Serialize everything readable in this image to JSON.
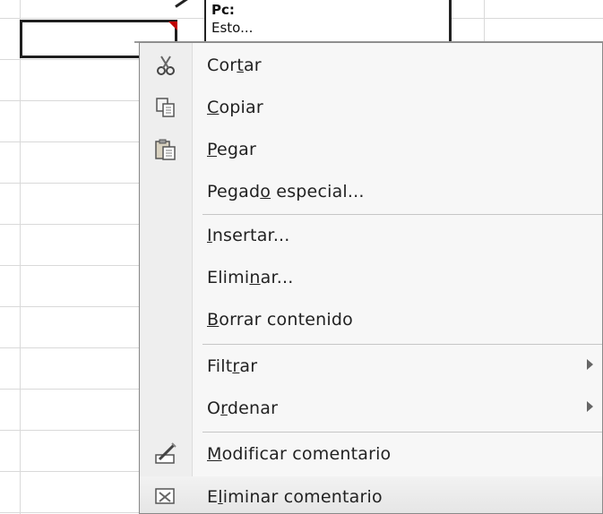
{
  "comment": {
    "author": "Pc:",
    "text": "Esto..."
  },
  "menu": {
    "items": [
      {
        "pre": "Cor",
        "acc": "t",
        "post": "ar",
        "icon": "scissors-icon"
      },
      {
        "pre": "",
        "acc": "C",
        "post": "opiar",
        "icon": "copy-icon"
      },
      {
        "pre": "",
        "acc": "P",
        "post": "egar",
        "icon": "paste-icon"
      },
      {
        "pre": "Pegad",
        "acc": "o",
        "post": " especial...",
        "icon": ""
      },
      {
        "pre": "",
        "acc": "I",
        "post": "nsertar...",
        "icon": ""
      },
      {
        "pre": "Elimi",
        "acc": "n",
        "post": "ar...",
        "icon": ""
      },
      {
        "pre": "",
        "acc": "B",
        "post": "orrar contenido",
        "icon": ""
      },
      {
        "pre": "Filt",
        "acc": "r",
        "post": "ar",
        "icon": "",
        "submenu": true
      },
      {
        "pre": "O",
        "acc": "r",
        "post": "denar",
        "icon": "",
        "submenu": true
      },
      {
        "pre": "",
        "acc": "M",
        "post": "odificar comentario",
        "icon": "edit-comment-icon"
      },
      {
        "pre": "E",
        "acc": "l",
        "post": "iminar comentario",
        "icon": "delete-comment-icon"
      }
    ]
  },
  "colors": {
    "menu_bg": "#f7f7f7",
    "icon_column": "#eeeeee",
    "comment_indicator": "#c00000"
  }
}
